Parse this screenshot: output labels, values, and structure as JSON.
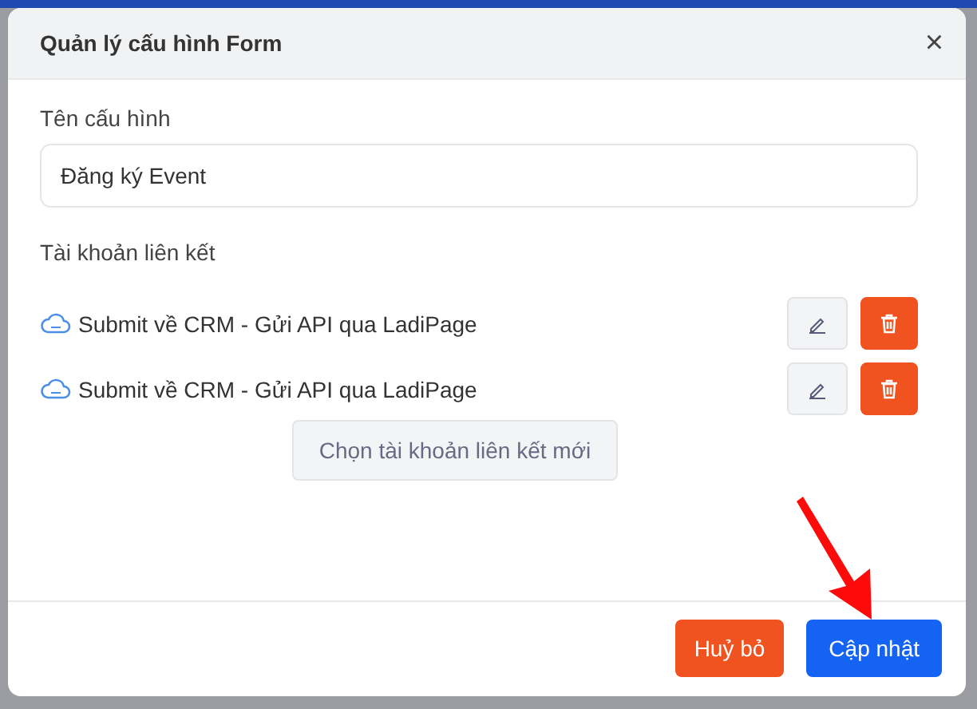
{
  "dialog": {
    "title": "Quản lý cấu hình Form",
    "close": "×"
  },
  "config_name": {
    "label": "Tên cấu hình",
    "value": "Đăng ký Event"
  },
  "linked_accounts": {
    "label": "Tài khoản liên kết",
    "items": [
      {
        "name": "Submit về CRM - Gửi API qua LadiPage"
      },
      {
        "name": "Submit về CRM - Gửi API qua LadiPage"
      }
    ],
    "add_button": "Chọn tài khoản liên kết mới"
  },
  "footer": {
    "buttons": [
      {
        "label": "Huỷ bỏ",
        "kind": "cancel"
      },
      {
        "label": "Cập nhật",
        "kind": "primary"
      }
    ]
  }
}
